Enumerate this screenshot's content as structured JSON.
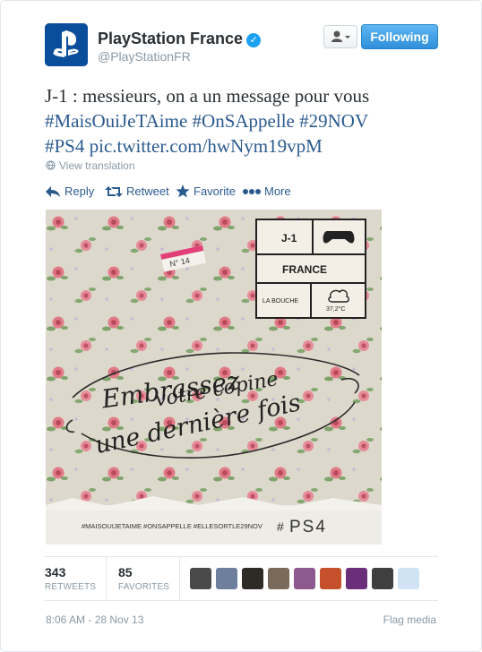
{
  "user": {
    "name": "PlayStation France",
    "handle": "@PlayStationFR"
  },
  "header": {
    "follow_label": "Following"
  },
  "tweet": {
    "line1": "J-1 : messieurs, on a un message pour vous",
    "hashtags": [
      "#MaisOuiJeTAime",
      "#OnSAppelle",
      "#29NOV",
      "#PS4"
    ],
    "link": "pic.twitter.com/hwNym19vpM",
    "translate_label": "View translation"
  },
  "actions": {
    "reply": "Reply",
    "retweet": "Retweet",
    "favorite": "Favorite",
    "more": "More"
  },
  "media": {
    "tag_text": "N° 14",
    "grid_j": "J-1",
    "grid_country": "FRANCE",
    "grid_city": "LA BOUCHE",
    "grid_temp": "37,2°C",
    "script_line1": "Embrassez",
    "script_line2": "votre copine",
    "script_line3": "une dernière fois",
    "footer_tags": "#MAISOUIJETAIME #ONSAPPELLE #ELLESORTLE29NOV",
    "footer_hash": "#",
    "footer_brand": "PS4"
  },
  "stats": {
    "retweets_count": "343",
    "retweets_label": "RETWEETS",
    "favorites_count": "85",
    "favorites_label": "FAVORITES"
  },
  "favoriters": [
    {
      "color": "#4a4a4a"
    },
    {
      "color": "#6d7f9c"
    },
    {
      "color": "#2e2a26"
    },
    {
      "color": "#7a6a5a"
    },
    {
      "color": "#8c5a8e"
    },
    {
      "color": "#c4512b"
    },
    {
      "color": "#6b2f7a"
    },
    {
      "color": "#3f3f3f"
    },
    {
      "color": "#cfe3f4"
    }
  ],
  "footer": {
    "timestamp": "8:06 AM - 28 Nov 13",
    "flag_label": "Flag media"
  },
  "colors": {
    "link": "#2b5a8f",
    "follow_button": "#2f8fd8",
    "muted": "#8899a6"
  }
}
